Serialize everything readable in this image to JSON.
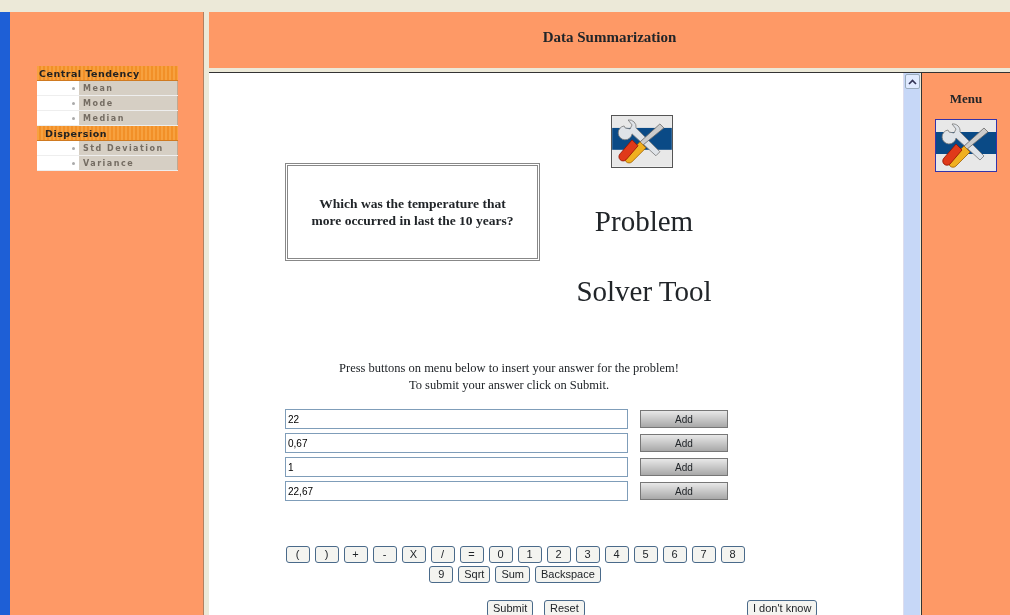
{
  "header": {
    "title": "Data Summarization"
  },
  "sidebar": {
    "groups": [
      {
        "label": "Central Tendency",
        "items": [
          {
            "label": "Mean"
          },
          {
            "label": "Mode"
          },
          {
            "label": "Median"
          }
        ]
      },
      {
        "label": "Dispersion",
        "items": [
          {
            "label": "Std Deviation"
          },
          {
            "label": "Variance"
          }
        ]
      }
    ]
  },
  "question": "Which was the temperature that more occurred in last the 10 years?",
  "tool_title": [
    "Problem",
    "Solver Tool"
  ],
  "instructions": [
    "Press buttons on menu below to insert your answer for the problem!",
    "To submit your answer click on Submit."
  ],
  "answers": [
    {
      "value": "22",
      "button": "Add"
    },
    {
      "value": "0,67",
      "button": "Add"
    },
    {
      "value": "1",
      "button": "Add"
    },
    {
      "value": "22,67",
      "button": "Add"
    }
  ],
  "keypad": [
    "(",
    ")",
    "+",
    "-",
    "X",
    "/",
    "=",
    "0",
    "1",
    "2",
    "3",
    "4",
    "5",
    "6",
    "7",
    "8",
    "9",
    "Sqrt",
    "Sum",
    "Backspace"
  ],
  "actions": [
    {
      "label": "Submit",
      "kind": "main"
    },
    {
      "label": "Reset",
      "kind": "main"
    },
    {
      "label": "I don't know",
      "kind": "aside"
    }
  ],
  "right_panel": {
    "title": "Menu"
  }
}
